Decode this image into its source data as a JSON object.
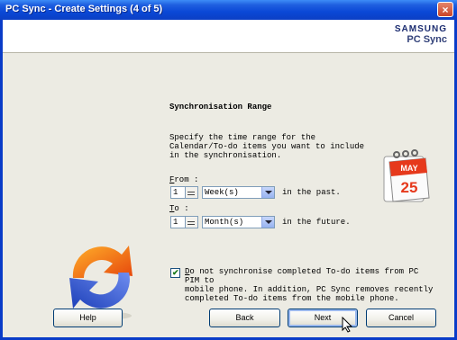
{
  "window": {
    "title": "PC Sync - Create Settings (4 of 5)",
    "close_glyph": "×"
  },
  "brand": {
    "top": "SAMSUNG",
    "bottom": "PC Sync"
  },
  "section": {
    "heading": "Synchronisation Range",
    "description": "Specify the time range for the\nCalendar/To-do items you want to include\nin the synchronisation."
  },
  "from": {
    "label_mnemonic": "F",
    "label_rest": "rom :",
    "number": "1",
    "unit": "Week(s)",
    "suffix": "in the past."
  },
  "to": {
    "label_mnemonic": "T",
    "label_rest": "o :",
    "number": "1",
    "unit": "Month(s)",
    "suffix": "in the future."
  },
  "checkbox": {
    "checked": true,
    "check_glyph": "✔",
    "mnemonic": "D",
    "text": "o not synchronise completed To-do items from PC PIM to\nmobile phone. In addition, PC Sync removes recently\ncompleted To-do items from the mobile phone."
  },
  "calendar_icon": {
    "month": "MAY",
    "day": "25"
  },
  "buttons": {
    "help": "Help",
    "back": "Back",
    "next": "Next",
    "cancel": "Cancel"
  },
  "colors": {
    "titlebar": "#0a48d6",
    "background": "#ecebe3",
    "accent_orange": "#e8580c",
    "accent_blue": "#2a5fd6"
  },
  "icons": [
    "close-icon",
    "sync-arrows-icon",
    "calendar-icon",
    "mouse-cursor-icon",
    "spin-icon",
    "dropdown-arrow-icon"
  ]
}
